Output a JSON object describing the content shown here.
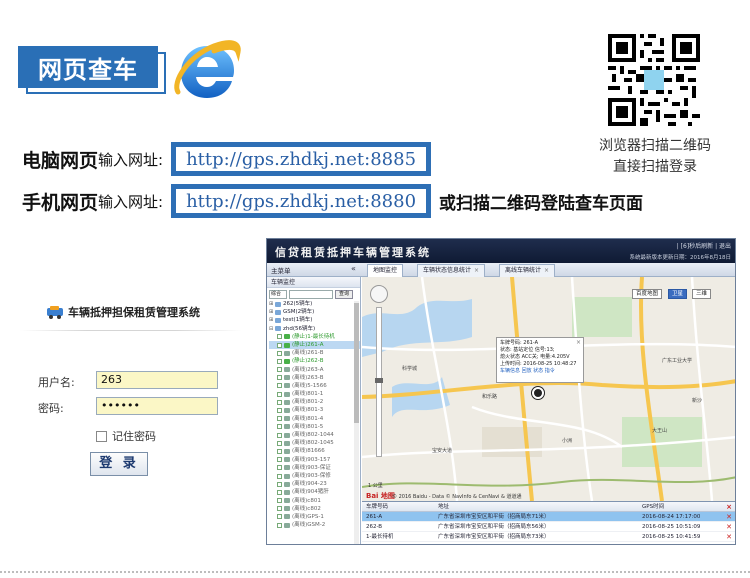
{
  "banner": {
    "badge_text": "网页查车",
    "qr_caption_line1": "浏览器扫描二维码",
    "qr_caption_line2": "直接扫描登录"
  },
  "addresses": {
    "pc": {
      "label_big": "电脑网页",
      "label_small": "输入网址:",
      "url": "http://gps.zhdkj.net:8885"
    },
    "mobile": {
      "label_big": "手机网页",
      "label_small": "输入网址:",
      "url": "http://gps.zhdkj.net:8880",
      "after": "或扫描二维码登陆查车页面"
    }
  },
  "login": {
    "title": "车辆抵押担保租赁管理系统",
    "username_label": "用户名:",
    "username_value": "263",
    "password_label": "密码:",
    "password_value": "••••••",
    "remember_label": "记住密码",
    "submit_label": "登 录"
  },
  "app": {
    "title": "信贷租赁抵押车辆管理系统",
    "links": "| [6]秒后刷新 | 退出",
    "subtitle": "系统最新版本更新日期：2016年8月18日",
    "menu_title": "主菜单",
    "collapse": "«",
    "tabs": [
      {
        "label": "地图监控"
      },
      {
        "label": "车辆状态信息统计"
      },
      {
        "label": "离线车辆统计"
      }
    ],
    "sidebar": {
      "head": "车辆监控",
      "filter": "综合",
      "search_button": "查询",
      "tree": [
        {
          "label": "262(5辆车)",
          "kind": "group"
        },
        {
          "label": "GSM(2辆车)",
          "kind": "group"
        },
        {
          "label": "test(1辆车)",
          "kind": "group"
        },
        {
          "label": "zhd(56辆车)",
          "kind": "group"
        },
        {
          "label": "(静止)1-最长待机",
          "kind": "online"
        },
        {
          "label": "(静止)261-A",
          "kind": "selected"
        },
        {
          "label": "(离线)261-B",
          "kind": "offline"
        },
        {
          "label": "(静止)262-B",
          "kind": "online"
        },
        {
          "label": "(离线)263-A",
          "kind": "offline"
        },
        {
          "label": "(离线)263-B",
          "kind": "offline"
        },
        {
          "label": "(离线)5-1566",
          "kind": "offline"
        },
        {
          "label": "(离线)801-1",
          "kind": "offline"
        },
        {
          "label": "(离线)801-2",
          "kind": "offline"
        },
        {
          "label": "(离线)801-3",
          "kind": "offline"
        },
        {
          "label": "(离线)801-4",
          "kind": "offline"
        },
        {
          "label": "(离线)801-5",
          "kind": "offline"
        },
        {
          "label": "(离线)802-1044",
          "kind": "offline"
        },
        {
          "label": "(离线)802-1045",
          "kind": "offline"
        },
        {
          "label": "(离线)81666",
          "kind": "offline"
        },
        {
          "label": "(离线)903-157",
          "kind": "offline"
        },
        {
          "label": "(离线)903-保证",
          "kind": "offline"
        },
        {
          "label": "(离线)903-保修",
          "kind": "offline"
        },
        {
          "label": "(离线)904-23",
          "kind": "offline"
        },
        {
          "label": "(离线)904猪肝",
          "kind": "offline"
        },
        {
          "label": "(离线)c801",
          "kind": "offline"
        },
        {
          "label": "(离线)c802",
          "kind": "offline"
        },
        {
          "label": "(离线)GPS-1",
          "kind": "offline"
        },
        {
          "label": "(离线)GSM-2",
          "kind": "offline"
        }
      ]
    },
    "map": {
      "controls": [
        "百度地图",
        "卫星",
        "三维"
      ],
      "popup": {
        "line1": "车牌号码: 261-A",
        "line2": "状态: 基站定位 信号:13;",
        "line3": "熄火状态 ACC关; 电量:4.205V",
        "line4": "上传时间: 2016-08-25 10:48:27",
        "links": "车辆信息   回放   状态   指令"
      },
      "labels": [
        "科学城",
        "和乐路",
        "广东工业大学",
        "大王山",
        "小洲",
        "新沙",
        "宝安大道"
      ],
      "scale": "1 公里",
      "brand": "Bai 地图",
      "copyright": "© 2016 Baidu - Data © NavInfo & CenNavi & 道道通"
    },
    "grid": {
      "headers": [
        "车牌号码",
        "地址",
        "GPS时间"
      ],
      "rows": [
        {
          "plate": "261-A",
          "address": "广东省深圳市宝安区和平街（招商局东71米）",
          "time": "2016-08-24 17:17:00"
        },
        {
          "plate": "262-B",
          "address": "广东省深圳市宝安区和平街（招商局东56米）",
          "time": "2016-08-25 10:51:09"
        },
        {
          "plate": "1-最长待机",
          "address": "广东省深圳市宝安区和平街（招商局东73米）",
          "time": "2016-08-25 10:41:59"
        }
      ]
    }
  },
  "colors": {
    "brand_blue": "#2a6fb6",
    "url_text": "#2a5fa5",
    "app_header": "#1f2d4d"
  }
}
